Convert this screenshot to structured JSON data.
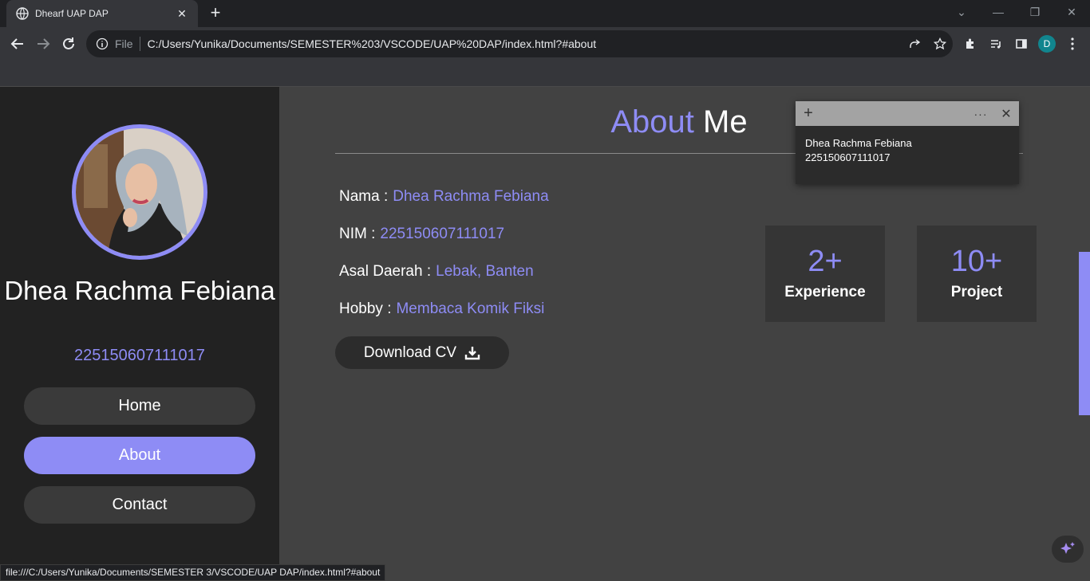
{
  "browser": {
    "tab_title": "Dhearf UAP DAP",
    "scheme_label": "File",
    "url": "C:/Users/Yunika/Documents/SEMESTER%203/VSCODE/UAP%20DAP/index.html?#about",
    "profile_initial": "D",
    "status_url": "file:///C:/Users/Yunika/Documents/SEMESTER 3/VSCODE/UAP DAP/index.html?#about"
  },
  "sidebar": {
    "name": "Dhea Rachma Febiana",
    "nim": "225150607111017",
    "nav": [
      {
        "label": "Home",
        "active": false
      },
      {
        "label": "About",
        "active": true
      },
      {
        "label": "Contact",
        "active": false
      }
    ]
  },
  "about": {
    "heading_accent": "About",
    "heading_rest": "Me",
    "rows": [
      {
        "label": "Nama :",
        "value": "Dhea Rachma Febiana"
      },
      {
        "label": "NIM :",
        "value": "225150607111017"
      },
      {
        "label": "Asal Daerah :",
        "value": "Lebak, Banten"
      },
      {
        "label": "Hobby :",
        "value": "Membaca Komik Fiksi"
      }
    ],
    "download_label": "Download CV",
    "stats": [
      {
        "number": "2+",
        "label": "Experience"
      },
      {
        "number": "10+",
        "label": "Project"
      }
    ]
  },
  "sticky_note": {
    "line1": "Dhea Rachma Febiana",
    "line2": "225150607111017"
  },
  "colors": {
    "accent": "#8e8cf5",
    "sidebar_bg": "#222222",
    "main_bg": "#424242"
  }
}
